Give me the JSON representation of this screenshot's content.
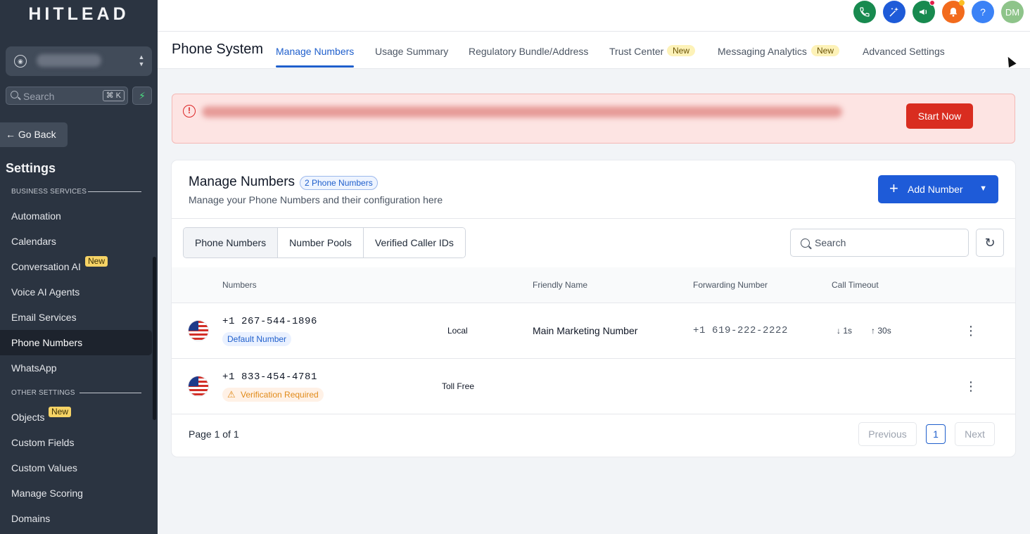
{
  "sidebar": {
    "logo": "HITLEAD",
    "search_placeholder": "Search",
    "search_shortcut": "⌘ K",
    "go_back": "Go Back",
    "settings_title": "Settings",
    "section_business": "BUSINESS SERVICES",
    "section_other": "OTHER SETTINGS",
    "new_label": "New",
    "items": [
      {
        "label": "Automation"
      },
      {
        "label": "Calendars"
      },
      {
        "label": "Conversation AI"
      },
      {
        "label": "Voice AI Agents"
      },
      {
        "label": "Email Services"
      },
      {
        "label": "Phone Numbers"
      },
      {
        "label": "WhatsApp"
      },
      {
        "label": "Objects"
      },
      {
        "label": "Custom Fields"
      },
      {
        "label": "Custom Values"
      },
      {
        "label": "Manage Scoring"
      },
      {
        "label": "Domains"
      }
    ]
  },
  "topbar": {
    "avatar_initials": "DM",
    "help_glyph": "?",
    "colors": {
      "phone": "#188a4f",
      "ai": "#1e5bd8",
      "megaphone": "#188a4f",
      "bell": "#f26b1d",
      "help": "#3b82f6",
      "avatar": "#8ec48a"
    }
  },
  "header": {
    "title": "Phone System",
    "tabs": [
      {
        "label": "Manage Numbers"
      },
      {
        "label": "Usage Summary"
      },
      {
        "label": "Regulatory Bundle/Address"
      },
      {
        "label": "Trust Center"
      },
      {
        "label": "Messaging Analytics"
      },
      {
        "label": "Advanced Settings"
      }
    ],
    "new_badge": "New"
  },
  "alert": {
    "button": "Start Now"
  },
  "card": {
    "title": "Manage Numbers",
    "count_badge": "2 Phone Numbers",
    "subtitle": "Manage your Phone Numbers and their configuration here",
    "add_button": "Add Number",
    "segments": [
      {
        "label": "Phone Numbers"
      },
      {
        "label": "Number Pools"
      },
      {
        "label": "Verified Caller IDs"
      }
    ],
    "search_placeholder": "Search",
    "columns": [
      "Numbers",
      "Friendly Name",
      "Forwarding Number",
      "Call Timeout"
    ],
    "rows": [
      {
        "number": "+1 267-544-1896",
        "tag": "Default Number",
        "type": "Local",
        "friendly_name": "Main Marketing Number",
        "forwarding": "+1 619-222-2222",
        "timeout_down": "1s",
        "timeout_up": "30s"
      },
      {
        "number": "+1 833-454-4781",
        "tag": "Verification Required",
        "type": "Toll Free",
        "friendly_name": "",
        "forwarding": "",
        "timeout_down": "",
        "timeout_up": ""
      }
    ],
    "page_info": "Page 1 of 1",
    "previous": "Previous",
    "current_page": "1",
    "next": "Next"
  }
}
